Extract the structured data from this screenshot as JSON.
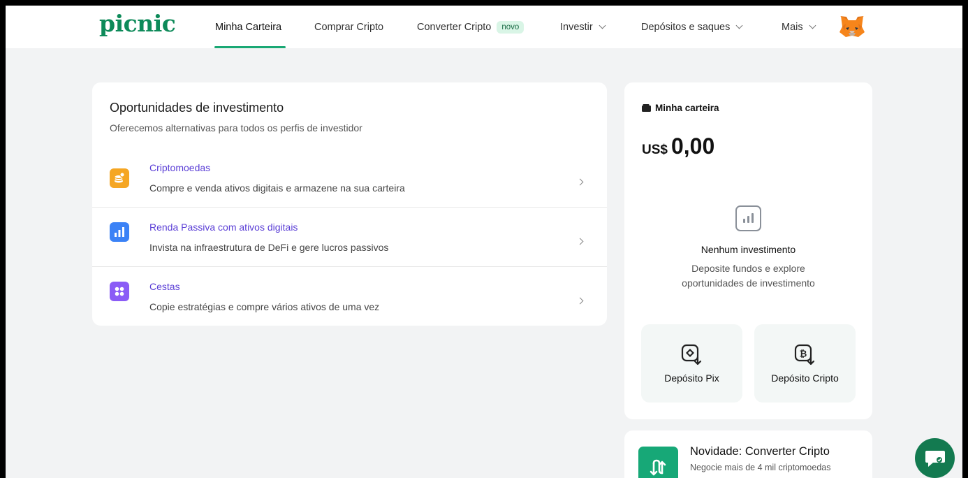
{
  "header": {
    "logo": "picnic",
    "nav": [
      {
        "label": "Minha Carteira"
      },
      {
        "label": "Comprar Cripto"
      },
      {
        "label": "Converter Cripto",
        "badge": "novo"
      },
      {
        "label": "Investir"
      },
      {
        "label": "Depósitos e saques"
      },
      {
        "label": "Mais"
      }
    ],
    "active_tab": "Minha Carteira"
  },
  "opportunities": {
    "title": "Oportunidades de investimento",
    "subtitle": "Oferecemos alternativas para todos os perfis de investidor",
    "items": [
      {
        "title": "Criptomoedas",
        "desc": "Compre e venda ativos digitais e armazene na sua carteira",
        "icon": "coins-icon",
        "color": "#f5a623"
      },
      {
        "title": "Renda Passiva com ativos digitais",
        "desc": "Invista na infraestrutura de DeFi e gere lucros passivos",
        "icon": "bar-chart-icon",
        "color": "#3b82f6"
      },
      {
        "title": "Cestas",
        "desc": "Copie estratégias e compre vários ativos de uma vez",
        "icon": "grid-dots-icon",
        "color": "#8b5cf6"
      }
    ]
  },
  "wallet": {
    "label": "Minha carteira",
    "currency": "US$",
    "balance": "0,00",
    "empty_title": "Nenhum investimento",
    "empty_subtitle": "Deposite fundos e explore oportunidades de investimento",
    "actions": [
      {
        "label": "Depósito Pix",
        "icon": "pix-deposit-icon"
      },
      {
        "label": "Depósito Cripto",
        "icon": "bitcoin-deposit-icon"
      }
    ]
  },
  "news": {
    "title": "Novidade: Converter Cripto",
    "subtitle": "Negocie mais de 4 mil criptomoedas"
  },
  "colors": {
    "brand": "#0d8a59",
    "accent_link": "#5b3fd6",
    "background": "#f2f3f4"
  }
}
